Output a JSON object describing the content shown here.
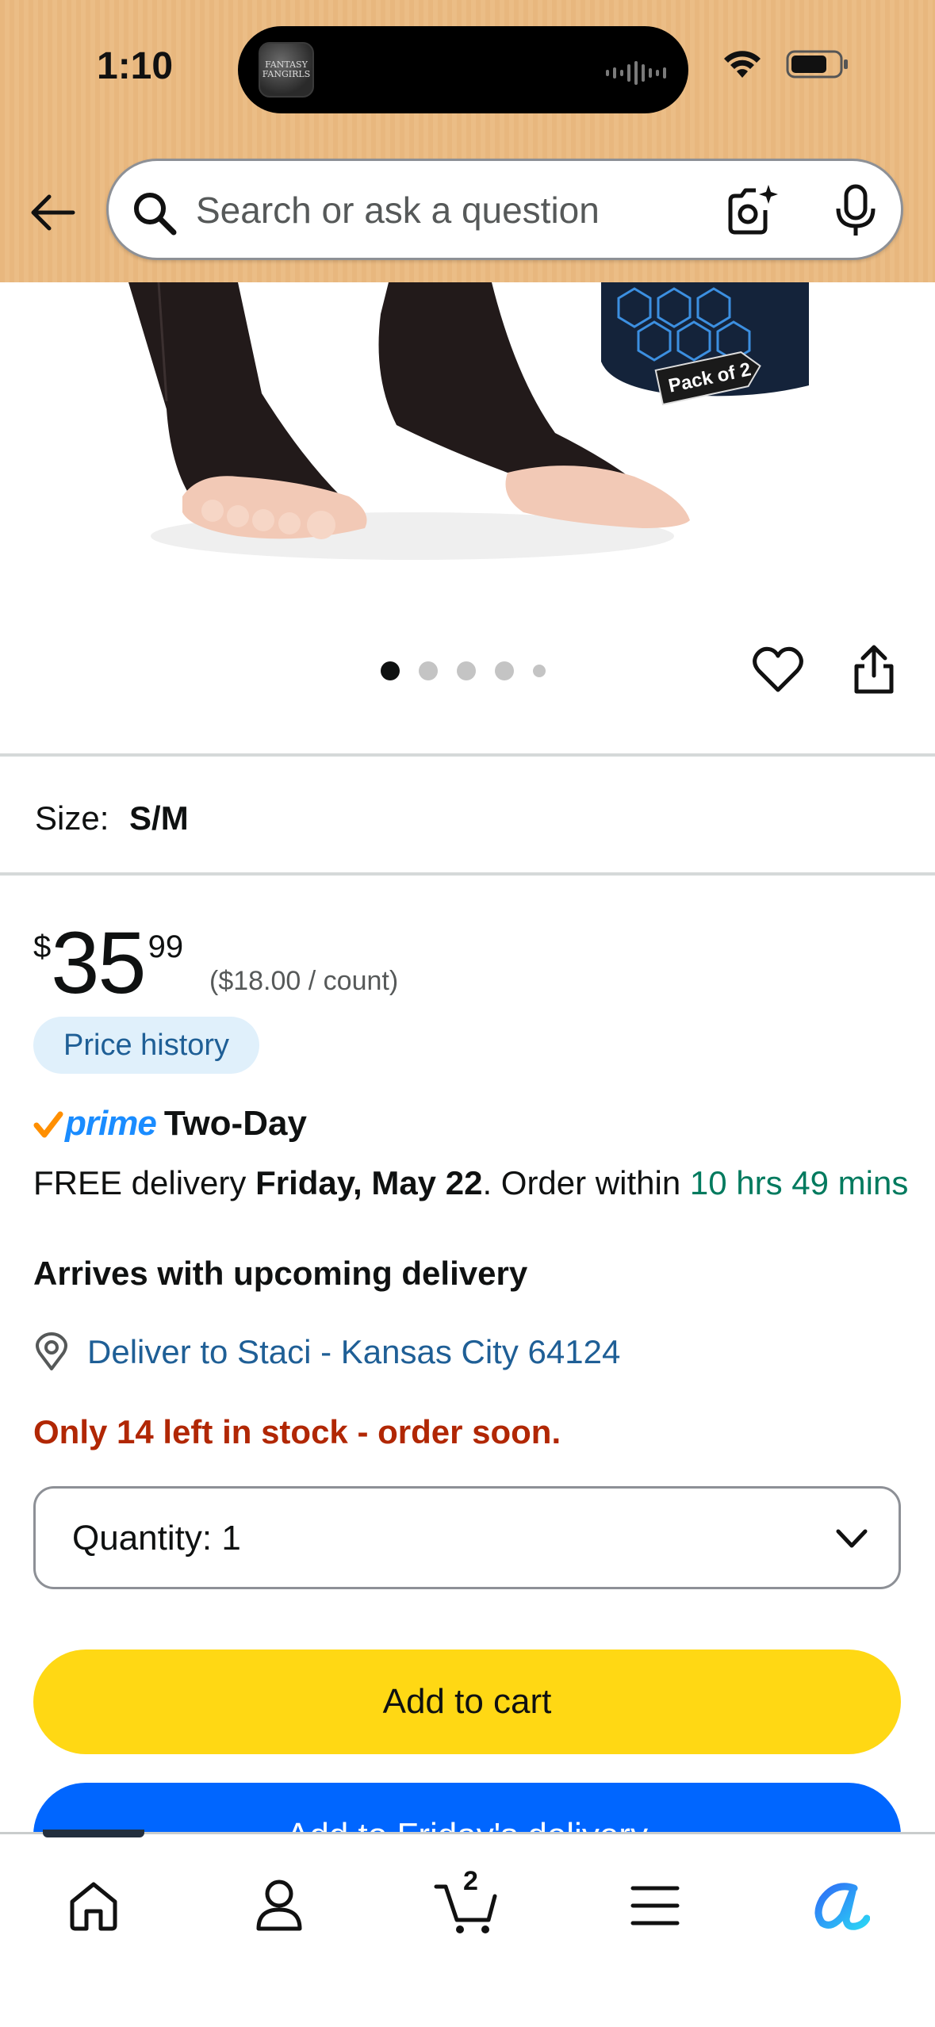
{
  "status_bar": {
    "time": "1:10",
    "island_avatar_text": "FANTASY FANGIRLS"
  },
  "header": {
    "search_placeholder": "Search or ask a question"
  },
  "product": {
    "image_tag": "Pack of 2",
    "carousel_count": 5,
    "carousel_active": 0,
    "size_label": "Size:",
    "size_value": "S/M",
    "price_symbol": "$",
    "price_whole": "35",
    "price_fraction": "99",
    "unit_price": "($18.00 / count)",
    "price_history_label": "Price history"
  },
  "delivery": {
    "prime_word": "prime",
    "prime_speed": "Two-Day",
    "free_delivery": "FREE delivery",
    "date": "Friday, May 22",
    "order_within": ". Order within",
    "countdown": "10 hrs 49 mins",
    "arrives": "Arrives with upcoming delivery",
    "deliver_to": "Deliver to Staci - Kansas City 64124"
  },
  "stock": {
    "message": "Only 14 left in stock - order soon."
  },
  "quantity": {
    "label": "Quantity:",
    "value": "1"
  },
  "buttons": {
    "add_to_cart": "Add to cart",
    "add_friday": "Add to Friday's delivery"
  },
  "bottom_nav": {
    "cart_count": "2",
    "items": [
      "home-icon",
      "account-icon",
      "cart-icon",
      "menu-icon",
      "rufus-icon"
    ]
  },
  "colors": {
    "header_bg": "#e8b77e",
    "add_to_cart": "#ffd814",
    "add_friday": "#0066ff",
    "stock": "#b12704",
    "link": "#1f5f96",
    "countdown": "#007a5e",
    "prime": "#1a8cff"
  }
}
